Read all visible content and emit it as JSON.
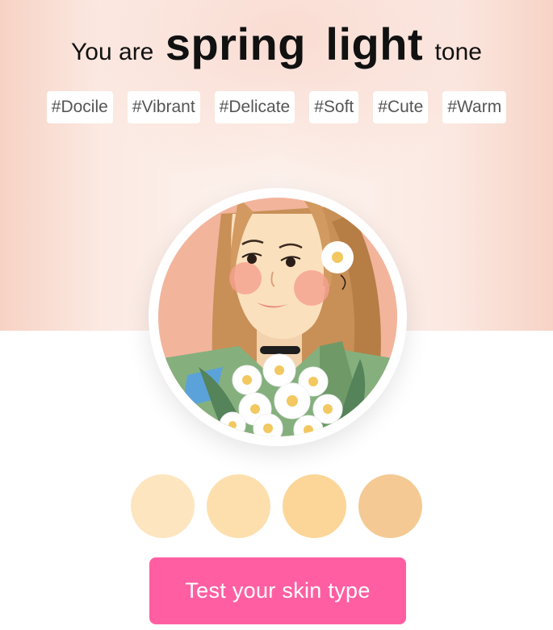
{
  "headline": {
    "prefix": "You are",
    "season": "spring",
    "shade": "light",
    "suffix": "tone"
  },
  "tags": [
    "#Docile",
    "#Vibrant",
    "#Delicate",
    "#Soft",
    "#Cute",
    "#Warm"
  ],
  "avatar": {
    "icon": "girl-with-daisies-illustration"
  },
  "swatches": [
    {
      "color": "#fde5c0"
    },
    {
      "color": "#fddfae"
    },
    {
      "color": "#fcd698"
    },
    {
      "color": "#f4c993"
    }
  ],
  "cta": {
    "label": "Test your skin type",
    "color": "#ff5fa2"
  }
}
